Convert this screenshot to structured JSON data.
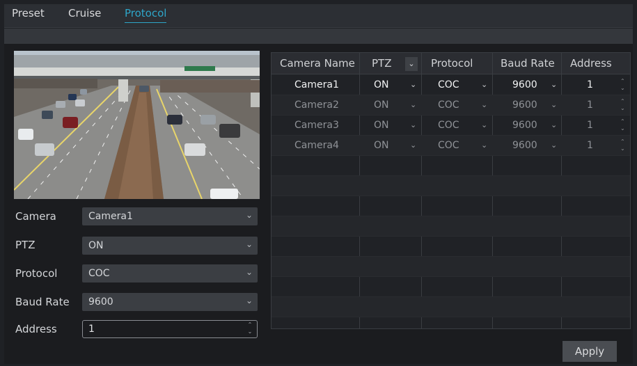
{
  "tabs": [
    {
      "label": "Preset"
    },
    {
      "label": "Cruise"
    },
    {
      "label": "Protocol",
      "active": true
    }
  ],
  "form": {
    "camera": {
      "label": "Camera",
      "value": "Camera1"
    },
    "ptz": {
      "label": "PTZ",
      "value": "ON"
    },
    "protocol": {
      "label": "Protocol",
      "value": "COC"
    },
    "baud_rate": {
      "label": "Baud Rate",
      "value": "9600"
    },
    "address": {
      "label": "Address",
      "value": "1"
    }
  },
  "table": {
    "headers": [
      "Camera Name",
      "PTZ",
      "Protocol",
      "Baud Rate",
      "Address"
    ],
    "rows": [
      {
        "camera": "Camera1",
        "ptz": "ON",
        "protocol": "COC",
        "baud": "9600",
        "address": "1"
      },
      {
        "camera": "Camera2",
        "ptz": "ON",
        "protocol": "COC",
        "baud": "9600",
        "address": "1"
      },
      {
        "camera": "Camera3",
        "ptz": "ON",
        "protocol": "COC",
        "baud": "9600",
        "address": "1"
      },
      {
        "camera": "Camera4",
        "ptz": "ON",
        "protocol": "COC",
        "baud": "9600",
        "address": "1"
      }
    ]
  },
  "apply_label": "Apply",
  "colors": {
    "accent": "#2ea6c9",
    "background": "#1b1c1f"
  },
  "icons": {
    "dropdown": "chevron-down-icon",
    "spinner": "up-down-arrows-icon"
  }
}
